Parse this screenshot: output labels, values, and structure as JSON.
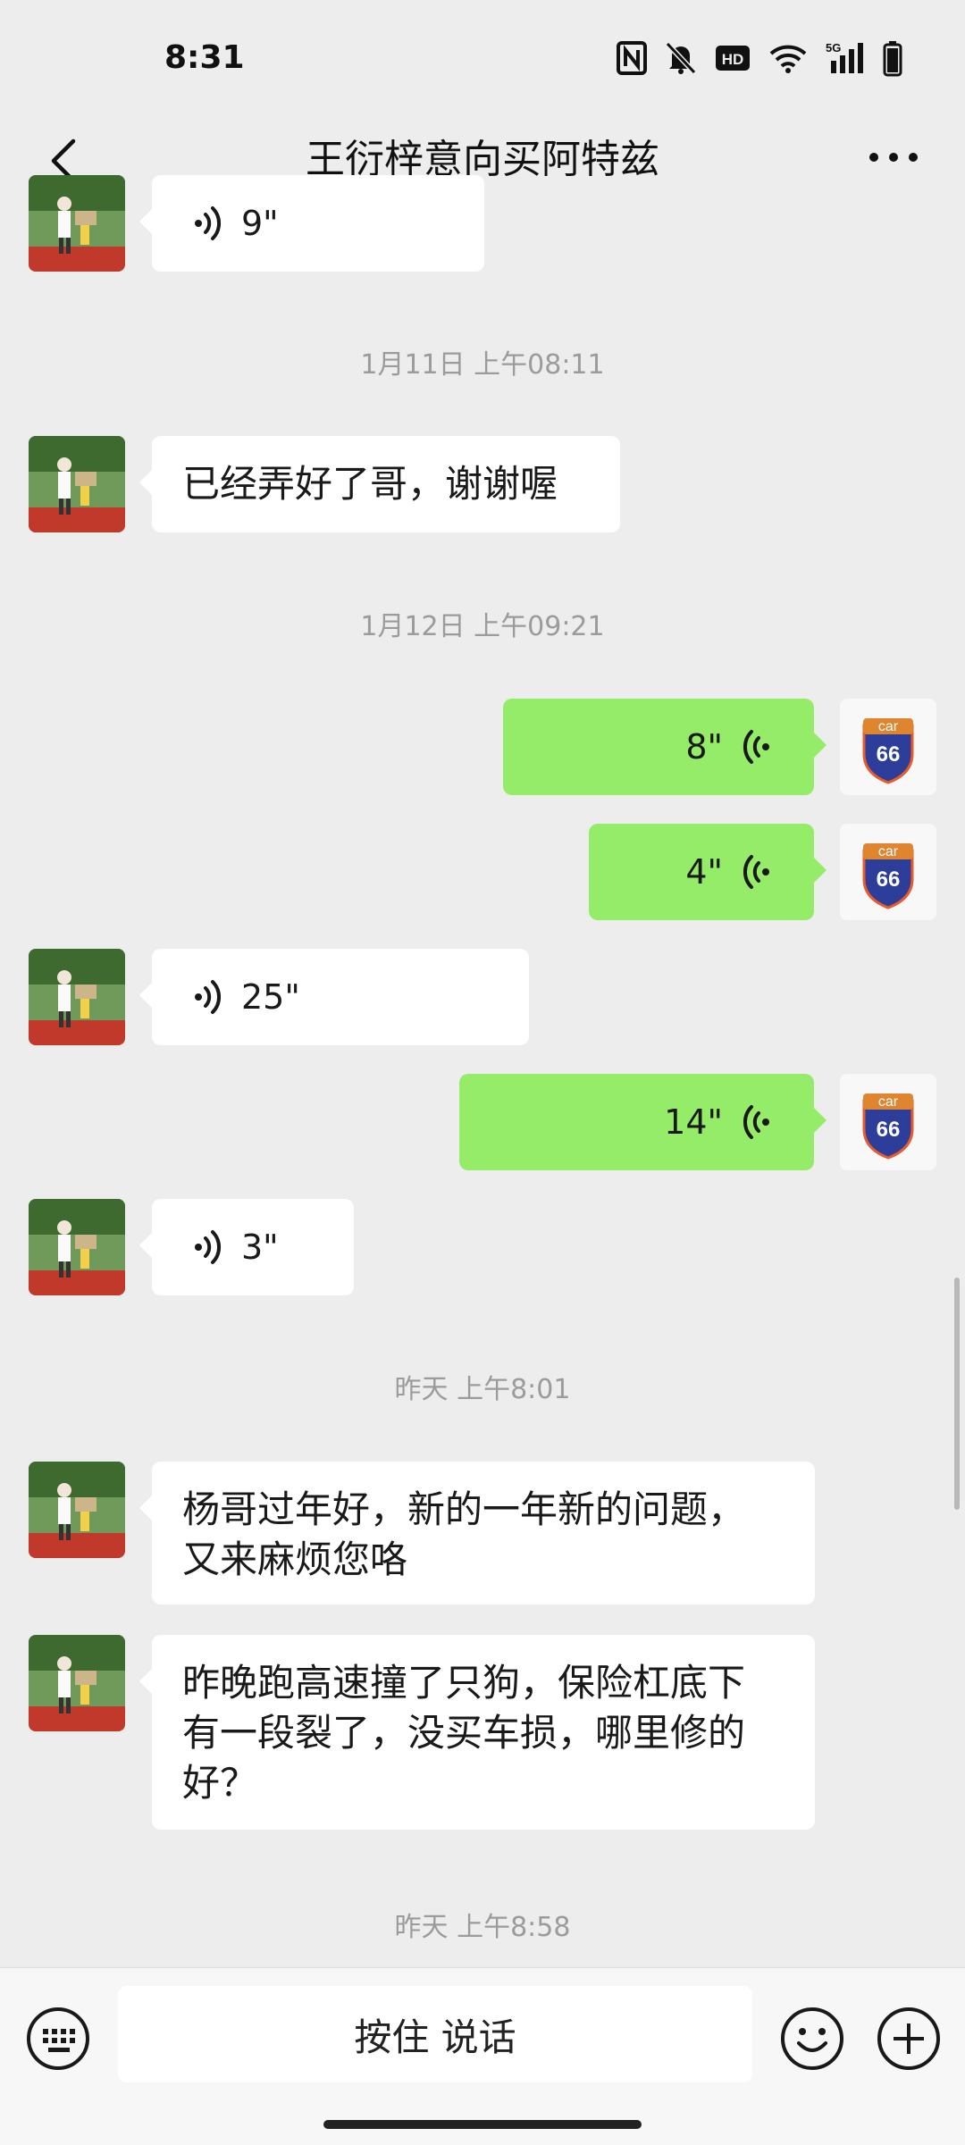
{
  "status": {
    "time": "8:31"
  },
  "header": {
    "title": "王衍梓意向买阿特兹"
  },
  "messages": [
    {
      "type": "voice",
      "direction": "in",
      "duration": "9\""
    },
    {
      "type": "timestamp",
      "text": "1月11日 上午08:11"
    },
    {
      "type": "text",
      "direction": "in",
      "text": "已经弄好了哥，谢谢喔"
    },
    {
      "type": "timestamp",
      "text": "1月12日 上午09:21"
    },
    {
      "type": "voice",
      "direction": "out",
      "duration": "8\""
    },
    {
      "type": "voice",
      "direction": "out",
      "duration": "4\""
    },
    {
      "type": "voice",
      "direction": "in",
      "duration": "25\""
    },
    {
      "type": "voice",
      "direction": "out",
      "duration": "14\""
    },
    {
      "type": "voice",
      "direction": "in",
      "duration": "3\""
    },
    {
      "type": "timestamp",
      "text": "昨天 上午8:01"
    },
    {
      "type": "text",
      "direction": "in",
      "lines": [
        "杨哥过年好，新的一年新的问题，",
        "又来麻烦您咯"
      ]
    },
    {
      "type": "text",
      "direction": "in",
      "lines": [
        "昨晚跑高速撞了只狗，保险杠底下",
        "有一段裂了，没买车损，哪里修的",
        "好？"
      ]
    },
    {
      "type": "timestamp",
      "text": "昨天 上午8:58"
    }
  ],
  "avatar_logo": {
    "top_text": "car",
    "number": "66"
  },
  "input_bar": {
    "hold_to_talk": "按住 说话"
  },
  "colors": {
    "background": "#ededed",
    "outgoing_bubble": "#95ec69",
    "incoming_bubble": "#ffffff"
  },
  "icons": [
    "back-arrow-icon",
    "more-dots-icon",
    "keyboard-icon",
    "emoji-icon",
    "plus-icon",
    "voice-wave-icon",
    "nfc-icon",
    "mute-bell-icon",
    "hd-icon",
    "wifi-icon",
    "signal-5g-icon",
    "battery-icon"
  ]
}
